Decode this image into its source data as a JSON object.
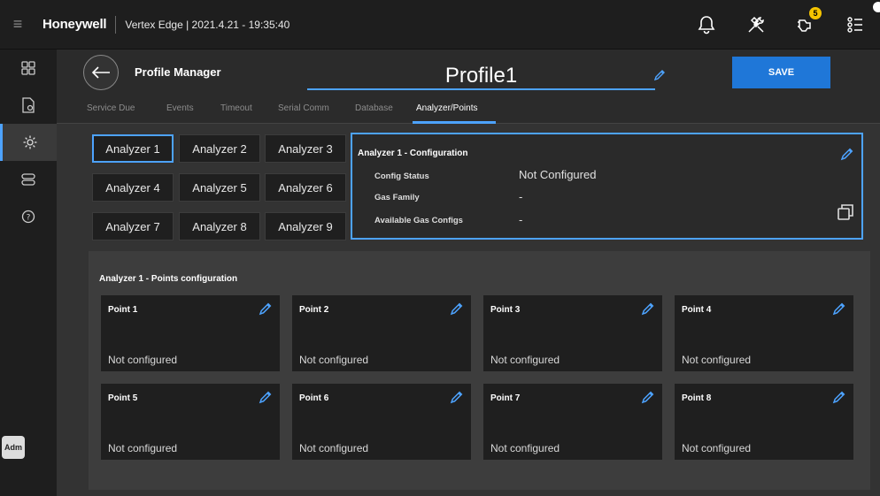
{
  "topbar": {
    "brand": "Honeywell",
    "title": "Vertex Edge | 2021.4.21 - 19:35:40",
    "notification_badge": "5"
  },
  "sidebar": {
    "items": [
      {
        "icon": "dashboard-grid-icon"
      },
      {
        "icon": "report-icon"
      },
      {
        "icon": "settings-gear-icon",
        "active": true
      },
      {
        "icon": "devices-icon"
      },
      {
        "icon": "help-icon"
      }
    ],
    "user": "Adm"
  },
  "header": {
    "title": "Profile Manager",
    "profile_name": "Profile1",
    "save_label": "SAVE"
  },
  "tabs": [
    {
      "label": "Service Due"
    },
    {
      "label": "Events"
    },
    {
      "label": "Timeout"
    },
    {
      "label": "Serial Comm"
    },
    {
      "label": "Database"
    },
    {
      "label": "Analyzer/Points",
      "active": true
    }
  ],
  "analyzers": [
    "Analyzer 1",
    "Analyzer 2",
    "Analyzer 3",
    "Analyzer 4",
    "Analyzer 5",
    "Analyzer 6",
    "Analyzer 7",
    "Analyzer 8",
    "Analyzer 9"
  ],
  "config": {
    "title": "Analyzer 1 - Configuration",
    "rows": [
      {
        "label": "Config Status",
        "value": "Not Configured"
      },
      {
        "label": "Gas Family",
        "value": "-"
      },
      {
        "label": "Available Gas Configs",
        "value": "-"
      }
    ]
  },
  "points": {
    "title": "Analyzer 1 - Points configuration",
    "items": [
      {
        "name": "Point 1",
        "status": "Not configured"
      },
      {
        "name": "Point 2",
        "status": "Not configured"
      },
      {
        "name": "Point 3",
        "status": "Not configured"
      },
      {
        "name": "Point 4",
        "status": "Not configured"
      },
      {
        "name": "Point 5",
        "status": "Not configured"
      },
      {
        "name": "Point 6",
        "status": "Not configured"
      },
      {
        "name": "Point 7",
        "status": "Not configured"
      },
      {
        "name": "Point 8",
        "status": "Not configured"
      }
    ]
  },
  "colors": {
    "accent": "#4da3ff",
    "save": "#1f77d8",
    "badge": "#f5c400"
  }
}
